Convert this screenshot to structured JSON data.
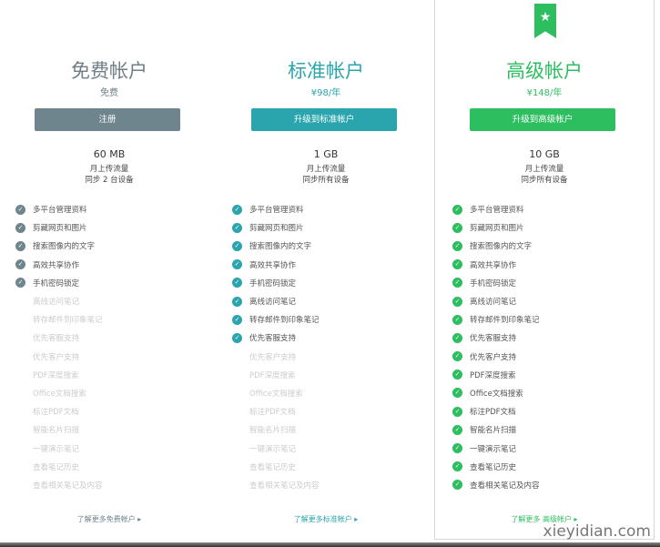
{
  "features": [
    "多平台管理资料",
    "剪藏网页和图片",
    "搜索图像内的文字",
    "高效共享协作",
    "手机密码锁定",
    "离线访问笔记",
    "转存邮件到印象笔记",
    "优先客服支持",
    "优先客户支持",
    "PDF深度搜索",
    "Office文档搜索",
    "标注PDF文档",
    "智能名片扫描",
    "一键演示笔记",
    "查看笔记历史",
    "查看相关笔记及内容"
  ],
  "plans": [
    {
      "title": "免费帐户",
      "price": "免费",
      "button": "注册",
      "storage": "60 MB",
      "upload": "月上传流量",
      "sync": "同步 2 台设备",
      "enabled_count": 5,
      "more": "了解更多免费帐户 ▸",
      "color": "#6f858d",
      "title_color": "#6f7f86"
    },
    {
      "title": "标准帐户",
      "price": "¥98/年",
      "button": "升级到标准帐户",
      "storage": "1 GB",
      "upload": "月上传流量",
      "sync": "同步所有设备",
      "enabled_count": 8,
      "more": "了解更多标准帐户 ▸",
      "color": "#2aa5ad",
      "title_color": "#2aa5ad"
    },
    {
      "title": "高级帐户",
      "price": "¥148/年",
      "button": "升级到高级帐户",
      "storage": "10 GB",
      "upload": "月上传流量",
      "sync": "同步所有设备",
      "enabled_count": 16,
      "more": "了解更多 高级帐户 ▸",
      "color": "#2dbe60",
      "title_color": "#2dbe60"
    }
  ],
  "ribbon_icon": "star-icon",
  "watermark": "xieyidian.com"
}
